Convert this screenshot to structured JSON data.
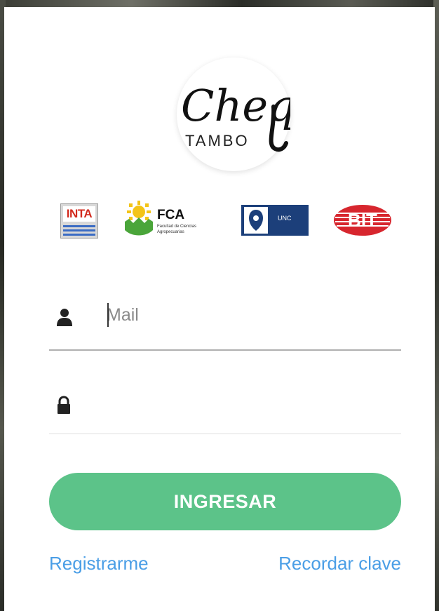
{
  "logo": {
    "brand_script": "Cheq",
    "brand_sub": "TAMBO"
  },
  "partners": {
    "inta": "INTA",
    "fca_title": "FCA",
    "fca_sub1": "Facultad de Ciencias",
    "fca_sub2": "Agropecuarias",
    "unc": "UNC",
    "bit": "BIT"
  },
  "form": {
    "mail_placeholder": "Mail",
    "mail_value": "",
    "password_value": "",
    "submit_label": "INGRESAR",
    "register_link": "Registrarme",
    "recover_link": "Recordar clave"
  },
  "icons": {
    "user": "user-icon",
    "lock": "lock-icon"
  },
  "colors": {
    "accent": "#5cc389",
    "link": "#4a9ee6",
    "inta_red": "#d22a1e",
    "unc_blue": "#1c3f7a",
    "bit_red": "#d7262e"
  }
}
